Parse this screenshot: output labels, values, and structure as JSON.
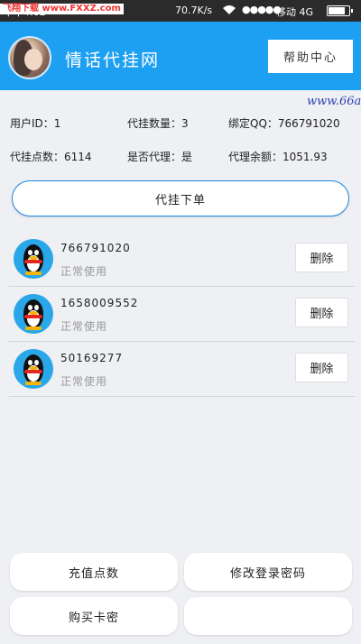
{
  "status_bar": {
    "time": "下午4:02",
    "watermark": "飞翔下载 www.FXXZ.com",
    "speed": "70.7K/s",
    "signal": "●●●●●",
    "carrier": "移动 4G"
  },
  "header": {
    "title": "情话代挂网",
    "help_label": "帮助中心"
  },
  "marquee": "www.66a",
  "info": {
    "user_id": "用户ID：1",
    "hang_count": "代挂数量：3",
    "bind_qq": "绑定QQ：766791020",
    "points": "代挂点数：6114",
    "is_agent": "是否代理：是",
    "agent_balance": "代理余额：1051.93"
  },
  "order_button": "代挂下单",
  "accounts": [
    {
      "qq": "766791020",
      "status": "正常使用",
      "delete_label": "删除"
    },
    {
      "qq": "1658009552",
      "status": "正常使用",
      "delete_label": "删除"
    },
    {
      "qq": "50169277",
      "status": "正常使用",
      "delete_label": "删除"
    }
  ],
  "bottom": {
    "recharge": "充值点数",
    "change_password": "修改登录密码",
    "buy_card": "购买卡密",
    "extra": ""
  }
}
